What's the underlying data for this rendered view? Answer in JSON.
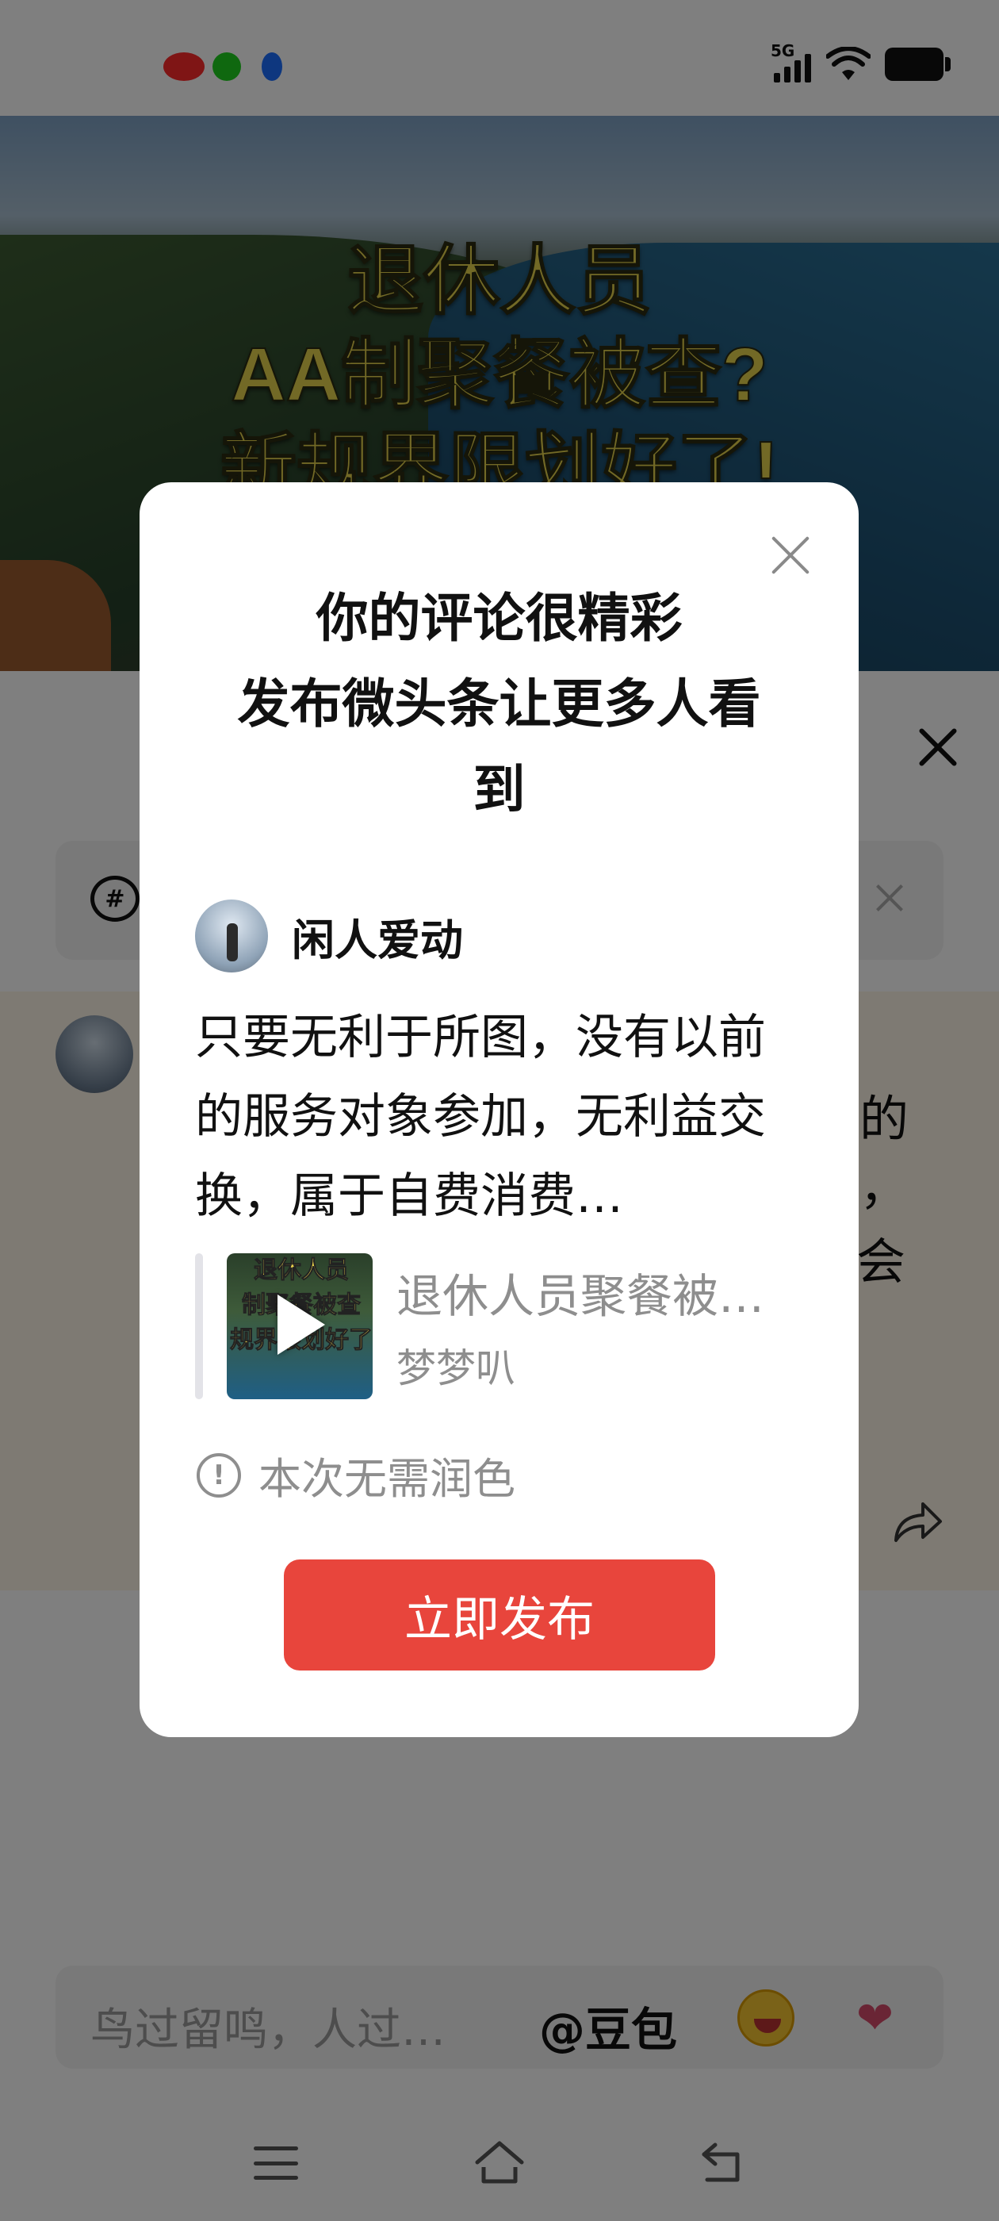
{
  "video": {
    "overlay_lines": [
      "退休人员",
      "AA制聚餐被查?",
      "新规界限划好了!"
    ]
  },
  "comment_sheet": {
    "topic_icon_glyph": "#",
    "background_comment_fragments": [
      "的",
      "，",
      "会"
    ]
  },
  "modal": {
    "title_lines": [
      "你的评论很精彩",
      "发布微头条让更多人看",
      "到"
    ],
    "author_name": "闲人爱动",
    "comment_text": "只要无利于所图，没有以前的服务对象参加，无利益交换，属于自费消费…",
    "quote": {
      "thumb_lines": [
        "退休人员",
        "制聚餐被查",
        "规界限划好了"
      ],
      "title": "退休人员聚餐被…",
      "author": "梦梦叭"
    },
    "polish_note": "本次无需润色",
    "info_glyph": "!",
    "publish_button": "立即发布"
  },
  "comment_input": {
    "placeholder": "鸟过留鸣，人过…",
    "mention": "@豆包",
    "emoji_2": "❤"
  },
  "icons": [
    "close-icon",
    "hashtag-icon",
    "share-icon",
    "play-icon",
    "info-icon",
    "menu-icon",
    "home-icon",
    "back-icon",
    "wifi-icon",
    "battery-icon",
    "signal-icon"
  ]
}
